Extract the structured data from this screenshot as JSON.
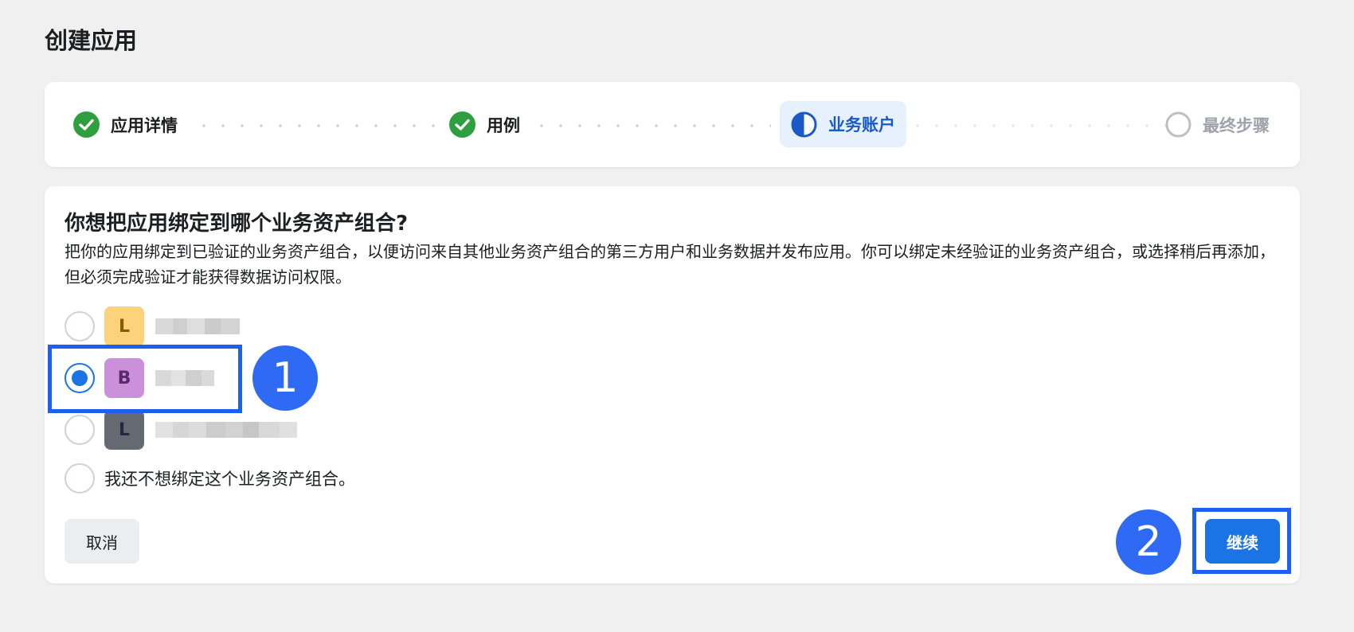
{
  "page_title": "创建应用",
  "stepper": {
    "steps": [
      {
        "label": "应用详情",
        "state": "done"
      },
      {
        "label": "用例",
        "state": "done"
      },
      {
        "label": "业务账户",
        "state": "current"
      },
      {
        "label": "最终步骤",
        "state": "upcoming"
      }
    ],
    "colors": {
      "done": "#2e9e3e",
      "current": "#1a5ac8",
      "upcoming": "#bcc0c4"
    }
  },
  "main": {
    "question": "你想把应用绑定到哪个业务资产组合?",
    "description": "把你的应用绑定到已验证的业务资产组合，以便访问来自其他业务资产组合的第三方用户和业务数据并发布应用。你可以绑定未经验证的业务资产组合，或选择稍后再添加，但必须完成验证才能获得数据访问权限。",
    "options": [
      {
        "avatar_letter": "L",
        "avatar_bg": "#fcd37a",
        "avatar_fg": "#8a5a00",
        "selected": false
      },
      {
        "avatar_letter": "B",
        "avatar_bg": "#cc8fd9",
        "avatar_fg": "#5a2a6a",
        "selected": true
      },
      {
        "avatar_letter": "L",
        "avatar_bg": "#656a72",
        "avatar_fg": "#1f2a40",
        "selected": false
      },
      {
        "text": "我还不想绑定这个业务资产组合。",
        "selected": false
      }
    ],
    "cancel_label": "取消",
    "continue_label": "继续"
  },
  "annotations": {
    "callout_1": "1",
    "callout_2": "2",
    "accent": "#1d5ff2"
  }
}
